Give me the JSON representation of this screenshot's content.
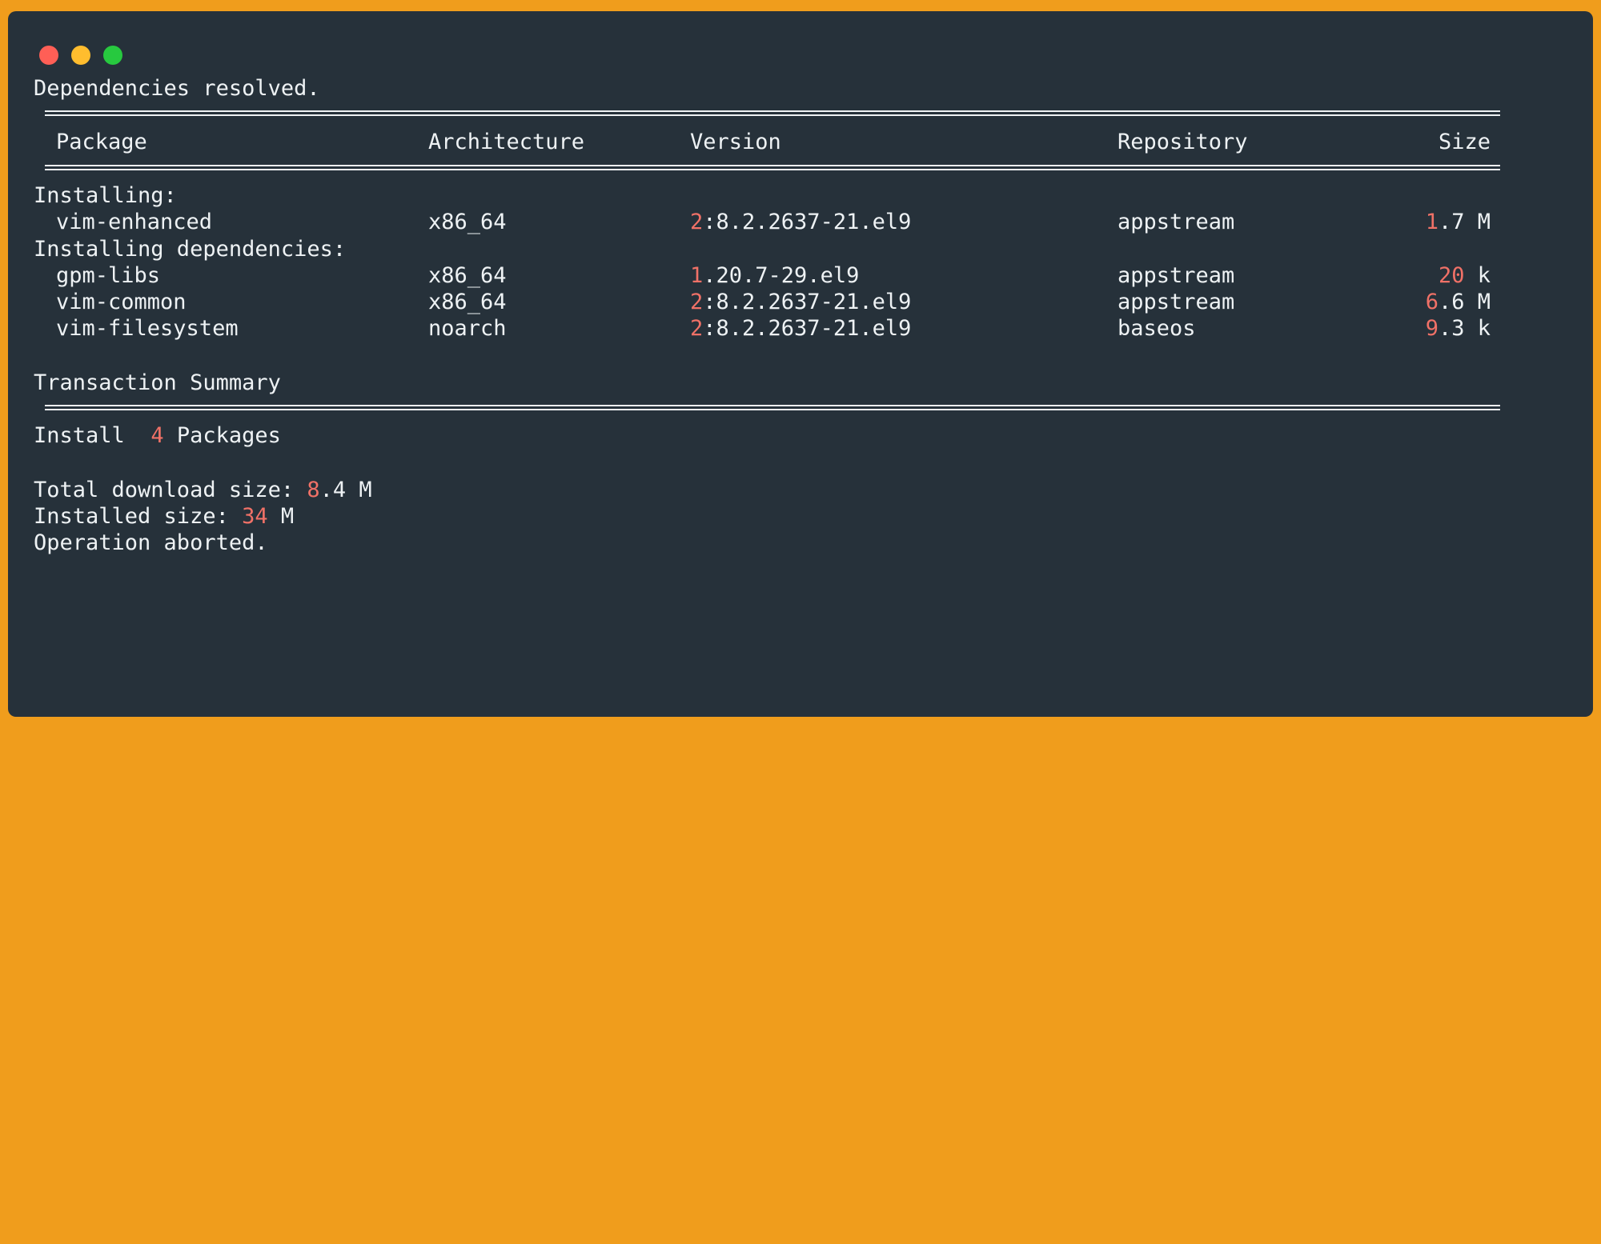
{
  "window": {
    "controls": [
      "close",
      "minimize",
      "maximize"
    ],
    "colors": {
      "close": "#ff5f56",
      "minimize": "#ffbd2e",
      "maximize": "#27c93f",
      "background": "#26313a",
      "frame": "#f09d1c",
      "accent_number": "#f07167"
    }
  },
  "output": {
    "resolved": "Dependencies resolved.",
    "headers": {
      "package": "Package",
      "arch": "Architecture",
      "version": "Version",
      "repo": "Repository",
      "size": "Size"
    },
    "section_installing": "Installing:",
    "section_deps": "Installing dependencies:",
    "rows": [
      {
        "package": "vim-enhanced",
        "arch": "x86_64",
        "version_lead": "2",
        "version_rest": ":8.2.2637-21.el9",
        "repo": "appstream",
        "size_lead": "1",
        "size_rest": ".7 M"
      },
      {
        "package": "gpm-libs",
        "arch": "x86_64",
        "version_lead": "1",
        "version_rest": ".20.7-29.el9",
        "repo": "appstream",
        "size_lead": "20",
        "size_rest": " k"
      },
      {
        "package": "vim-common",
        "arch": "x86_64",
        "version_lead": "2",
        "version_rest": ":8.2.2637-21.el9",
        "repo": "appstream",
        "size_lead": "6",
        "size_rest": ".6 M"
      },
      {
        "package": "vim-filesystem",
        "arch": "noarch",
        "version_lead": "2",
        "version_rest": ":8.2.2637-21.el9",
        "repo": "baseos",
        "size_lead": "9",
        "size_rest": ".3 k"
      }
    ],
    "summary_title": "Transaction Summary",
    "install_prefix": "Install  ",
    "install_count": "4",
    "install_suffix": " Packages",
    "download_prefix": "Total download size: ",
    "download_lead": "8",
    "download_rest": ".4 M",
    "installed_prefix": "Installed size: ",
    "installed_lead": "34",
    "installed_rest": " M",
    "aborted": "Operation aborted."
  }
}
